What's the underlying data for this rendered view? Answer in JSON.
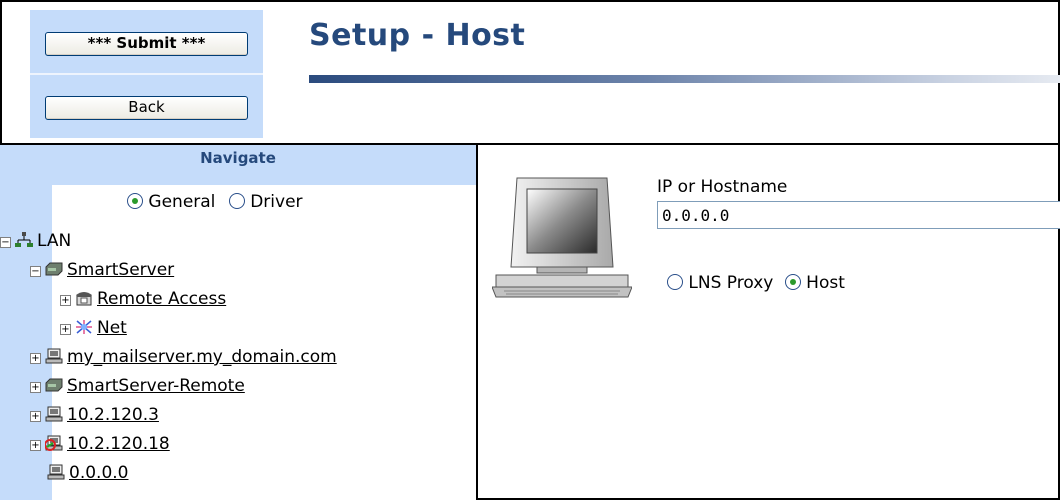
{
  "header": {
    "submit_label": "*** Submit ***",
    "back_label": "Back",
    "title": "Setup - Host"
  },
  "nav": {
    "title": "Navigate",
    "modes": [
      {
        "label": "General",
        "checked": true
      },
      {
        "label": "Driver",
        "checked": false
      }
    ],
    "tree": [
      {
        "label": "LAN",
        "icon": "network-icon",
        "expander": "minus",
        "link": false
      },
      {
        "label": "SmartServer",
        "icon": "smartserver-icon",
        "expander": "minus",
        "link": true
      },
      {
        "label": "Remote Access",
        "icon": "telephone-icon",
        "expander": "plus",
        "link": true
      },
      {
        "label": "Net",
        "icon": "net-icon",
        "expander": "plus",
        "link": true
      },
      {
        "label": "my_mailserver.my_domain.com",
        "icon": "computer-icon",
        "expander": "plus",
        "link": true
      },
      {
        "label": "SmartServer-Remote",
        "icon": "smartserver-icon",
        "expander": "plus",
        "link": true
      },
      {
        "label": "10.2.120.3",
        "icon": "computer-icon",
        "expander": "plus",
        "link": true
      },
      {
        "label": "10.2.120.18",
        "icon": "computer-alert-icon",
        "expander": "plus",
        "link": true
      },
      {
        "label": "0.0.0.0",
        "icon": "computer-icon",
        "expander": "none",
        "link": true
      }
    ]
  },
  "form": {
    "ip_label": "IP or Hostname",
    "ip_value": "0.0.0.0",
    "roles": [
      {
        "label": "LNS Proxy",
        "checked": false
      },
      {
        "label": "Host",
        "checked": true
      }
    ]
  },
  "colors": {
    "panel_blue": "#c5dcfa",
    "title_navy": "#25497c",
    "radio_selected": "#2b9a2b"
  }
}
